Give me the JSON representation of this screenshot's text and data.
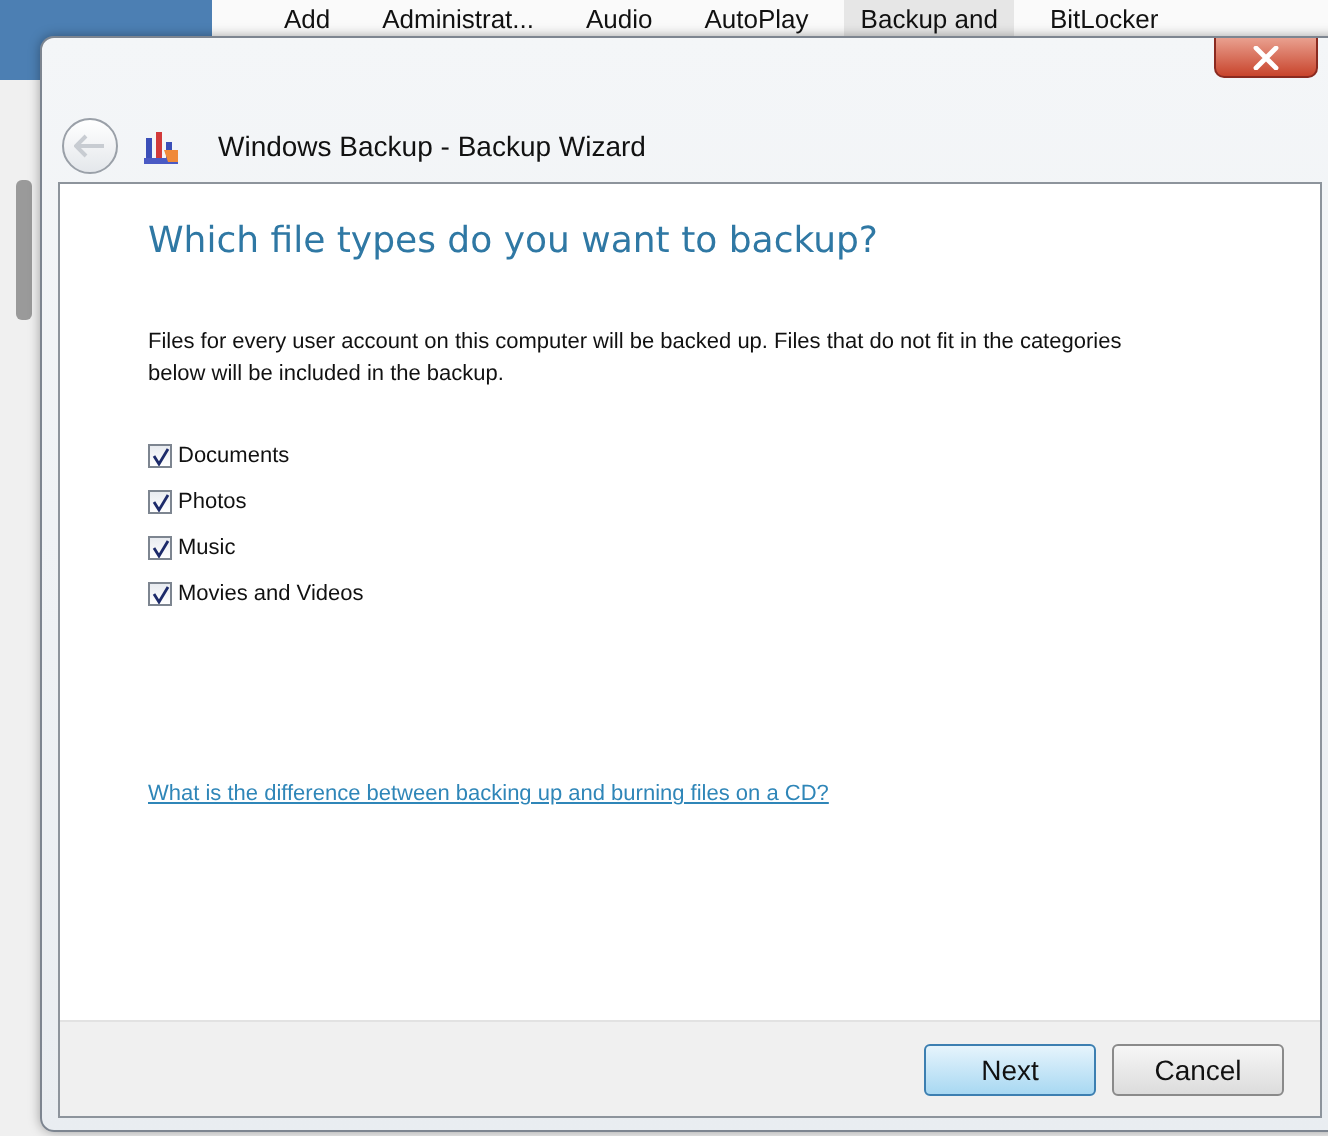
{
  "background_window": {
    "items": [
      {
        "label": "Add",
        "selected": false
      },
      {
        "label": "Administrat...",
        "selected": false
      },
      {
        "label": "Audio",
        "selected": false
      },
      {
        "label": "AutoPlay",
        "selected": false
      },
      {
        "label": "Backup and",
        "selected": true
      },
      {
        "label": "BitLocker",
        "selected": false
      }
    ]
  },
  "window": {
    "title": "Windows Backup - Backup Wizard"
  },
  "heading": "Which file types do you want to backup?",
  "description": "Files for every user account on this computer will be backed up. Files that do not fit in the categories below will be included in the backup.",
  "options": [
    {
      "label": "Documents",
      "checked": true
    },
    {
      "label": "Photos",
      "checked": true
    },
    {
      "label": "Music",
      "checked": true
    },
    {
      "label": "Movies and Videos",
      "checked": true
    }
  ],
  "help_link": "What is the difference between backing up and burning files on a CD?",
  "buttons": [
    {
      "label": "Next",
      "default": true
    },
    {
      "label": "Cancel",
      "default": false
    }
  ]
}
